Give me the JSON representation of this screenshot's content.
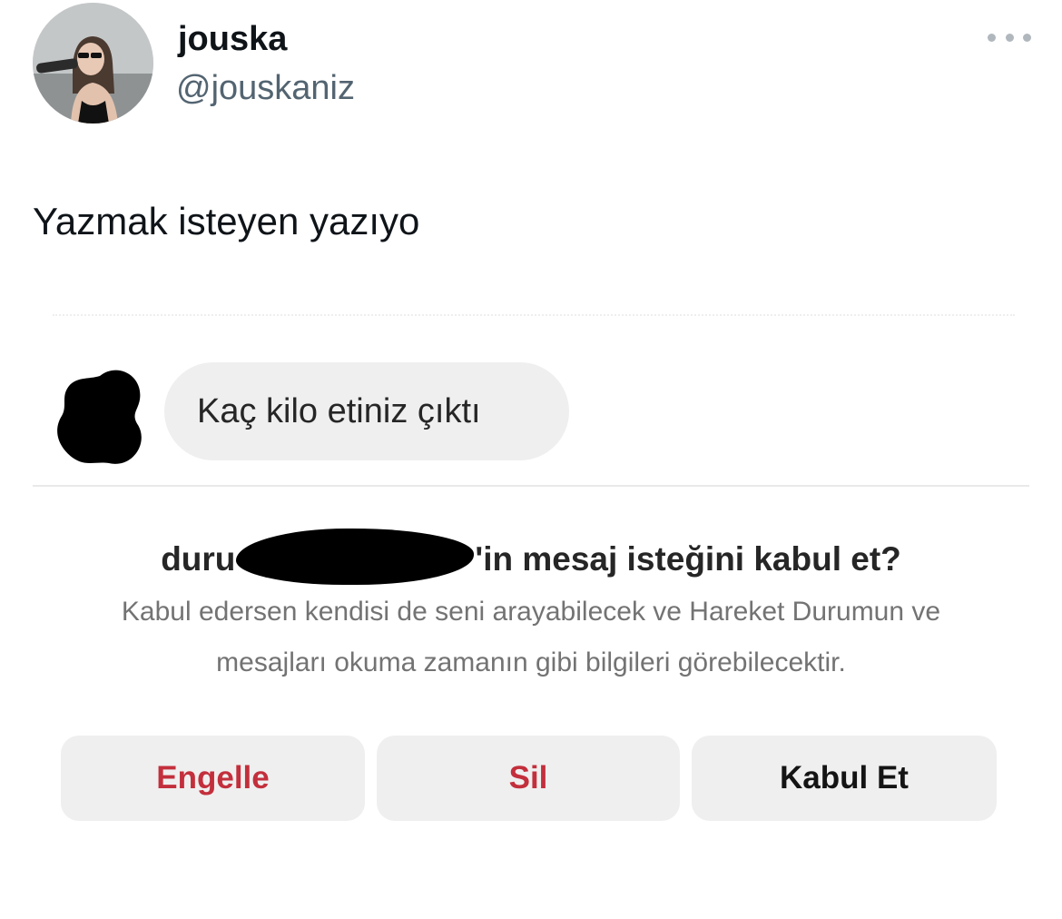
{
  "tweet": {
    "display_name": "jouska",
    "handle": "@jouskaniz",
    "more_icon": "more-horizontal-icon",
    "text": "Yazmak isteyen yazıyo"
  },
  "embedded_screenshot": {
    "message": {
      "text": "Kaç kilo etiniz çıktı"
    },
    "request": {
      "name_prefix": "duru",
      "name_suffix": "'in mesaj isteğini kabul et?",
      "description_lines": [
        "Kabul edersen kendisi de seni arayabilecek ve Hareket Durumun ve",
        "mesajları okuma zamanın gibi bilgileri görebilecektir."
      ]
    },
    "buttons": {
      "block_label": "Engelle",
      "delete_label": "Sil",
      "accept_label": "Kabul Et"
    },
    "colors": {
      "destructive": "#c32f3c",
      "button_bg": "#efefef",
      "bubble_bg": "#efefef"
    }
  }
}
